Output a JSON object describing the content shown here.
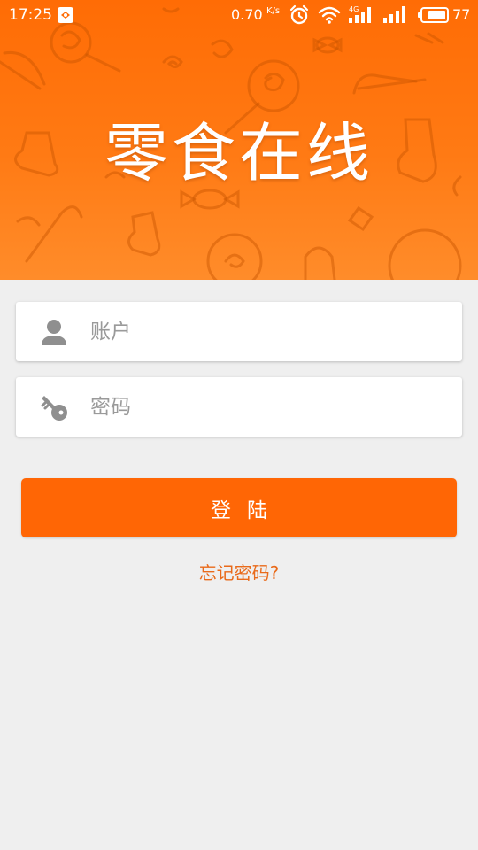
{
  "status_bar": {
    "time": "17:25",
    "speed": "0.70",
    "speed_unit": "K/s",
    "network_type": "4G",
    "battery": "77"
  },
  "header": {
    "title": "零食在线"
  },
  "form": {
    "account_placeholder": "账户",
    "password_placeholder": "密码",
    "login_label": "登陆",
    "forgot_label": "忘记密码?"
  },
  "colors": {
    "brand_orange": "#ff6605",
    "link_orange": "#e96a1a",
    "background": "#efefef"
  }
}
